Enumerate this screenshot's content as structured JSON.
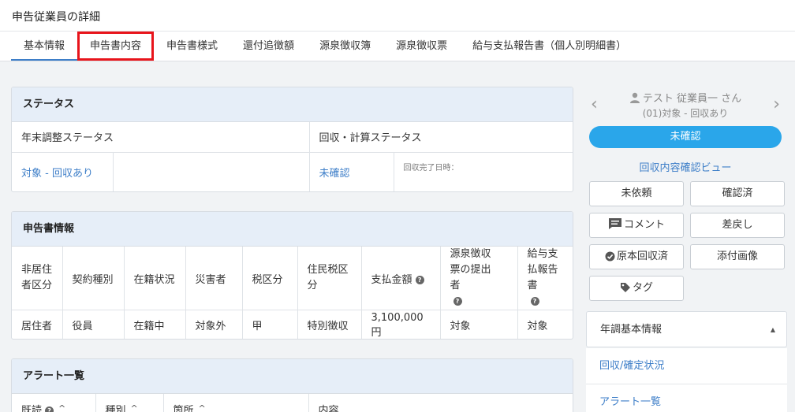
{
  "page": {
    "title": "申告従業員の詳細"
  },
  "tabs": [
    {
      "label": "基本情報"
    },
    {
      "label": "申告書内容"
    },
    {
      "label": "申告書様式"
    },
    {
      "label": "還付追徴額"
    },
    {
      "label": "源泉徴収簿"
    },
    {
      "label": "源泉徴収票"
    },
    {
      "label": "給与支払報告書（個人別明細書）"
    }
  ],
  "status": {
    "title": "ステータス",
    "year_end_label": "年末調整ステータス",
    "collection_label": "回収・計算ステータス",
    "year_end_value": "対象 - 回収あり",
    "collection_value": "未確認",
    "completed_label": "回収完了日時："
  },
  "declaration": {
    "title": "申告書情報",
    "headers": [
      "非居住者区分",
      "契約種別",
      "在籍状況",
      "災害者",
      "税区分",
      "住民税区分",
      "支払金額",
      "源泉徴収票の提出者",
      "給与支払報告書"
    ],
    "values": [
      "居住者",
      "役員",
      "在籍中",
      "対象外",
      "甲",
      "特別徴収",
      "3,100,000円",
      "対象",
      "対象"
    ]
  },
  "alerts": {
    "title": "アラート一覧",
    "headers": [
      "既読",
      "種別",
      "箇所",
      "内容"
    ]
  },
  "side": {
    "employee_name": "テスト 従業員一 さん",
    "employee_status": "(01)対象 - 回収あり",
    "confirm_label": "未確認",
    "view_link": "回収内容確認ビュー",
    "buttons": {
      "not_requested": "未依頼",
      "confirmed": "確認済",
      "comment": "コメント",
      "return": "差戻し",
      "original": "原本回収済",
      "attachment": "添付画像",
      "tag": "タグ"
    },
    "accordion_label": "年調基本情報",
    "links": [
      "回収/確定状況",
      "アラート一覧"
    ]
  }
}
